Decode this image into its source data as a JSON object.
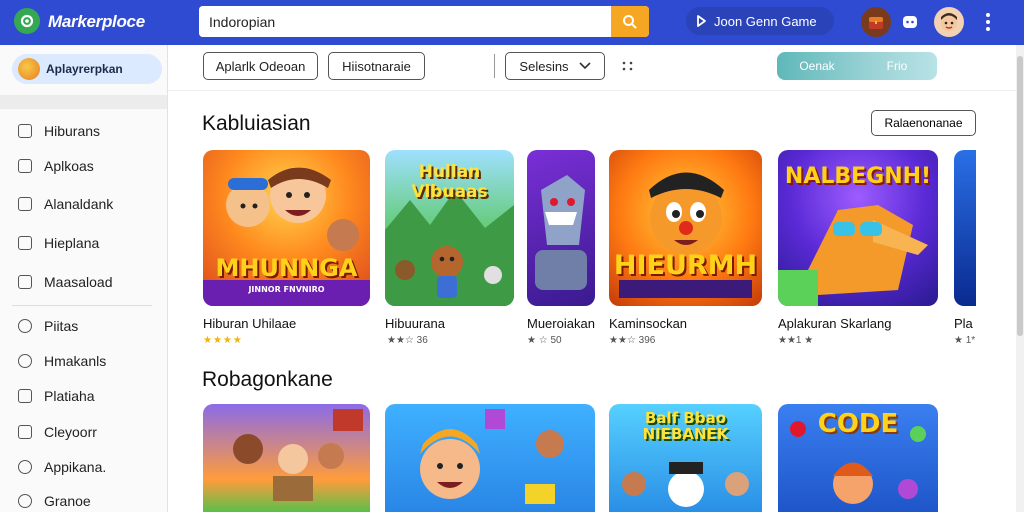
{
  "app": {
    "title": "Markerploce"
  },
  "search": {
    "value": "Indoropian"
  },
  "header": {
    "open_game_label": "Joon Genn Game"
  },
  "colors": {
    "topbar": "#2f4bd1",
    "accent": "#f5a623",
    "toggle": "#5fb8b9"
  },
  "sidebar": {
    "account_label": "Aplayrerpkan",
    "items": [
      {
        "label": "Hiburans",
        "icon": "grid-icon"
      },
      {
        "label": "Aplkoas",
        "icon": "apps-icon"
      },
      {
        "label": "Alanaldank",
        "icon": "bookmark-icon"
      },
      {
        "label": "Hieplana",
        "icon": "gamepad-icon"
      },
      {
        "label": "Maasaload",
        "icon": "download-icon"
      },
      {
        "label": "Piitas",
        "icon": "play-icon"
      },
      {
        "label": "Hmakanls",
        "icon": "settings-icon"
      },
      {
        "label": "Platiaha",
        "icon": "puzzle-icon"
      },
      {
        "label": "Cleyoorr",
        "icon": "chat-icon"
      },
      {
        "label": "Appikana.",
        "icon": "location-icon"
      },
      {
        "label": "Granoe",
        "icon": "map-icon"
      }
    ]
  },
  "filters": {
    "btn1": "Aplarlk Odeoan",
    "btn2": "Hiisotnaraie",
    "sort": "Selesins",
    "toggle_left": "Oenak",
    "toggle_right": "Frio"
  },
  "section1": {
    "title": "Kabluiasian",
    "see_more": "Ralaenonanae",
    "cards": [
      {
        "label": "Hiburan Uhilaae",
        "rating": "★★★★",
        "art": "MHUNNGA",
        "art_sub": "JINNOR FNVNIRO"
      },
      {
        "label": "Hibuurana",
        "rating": "★★☆ 36",
        "art": "Hullan Vlbuaas",
        "art_sub": ""
      },
      {
        "label": "Mueroiakan",
        "rating": "★ ☆ 50",
        "art": "",
        "art_sub": ""
      },
      {
        "label": "Kaminsockan",
        "rating": "★★☆ 396",
        "art": "HIEURMH",
        "art_sub": ""
      },
      {
        "label": "Aplakuran Skarlang",
        "rating": "★★1 ★",
        "art": "NALBEGNH!",
        "art_sub": ""
      },
      {
        "label": "Pla",
        "rating": "★ 1*",
        "art": "",
        "art_sub": ""
      }
    ]
  },
  "section2": {
    "title": "Robagonkane",
    "cards": [
      {
        "art": ""
      },
      {
        "art": ""
      },
      {
        "art": "Balf Bbao NIEBANEK"
      },
      {
        "art": "CODE"
      }
    ]
  }
}
